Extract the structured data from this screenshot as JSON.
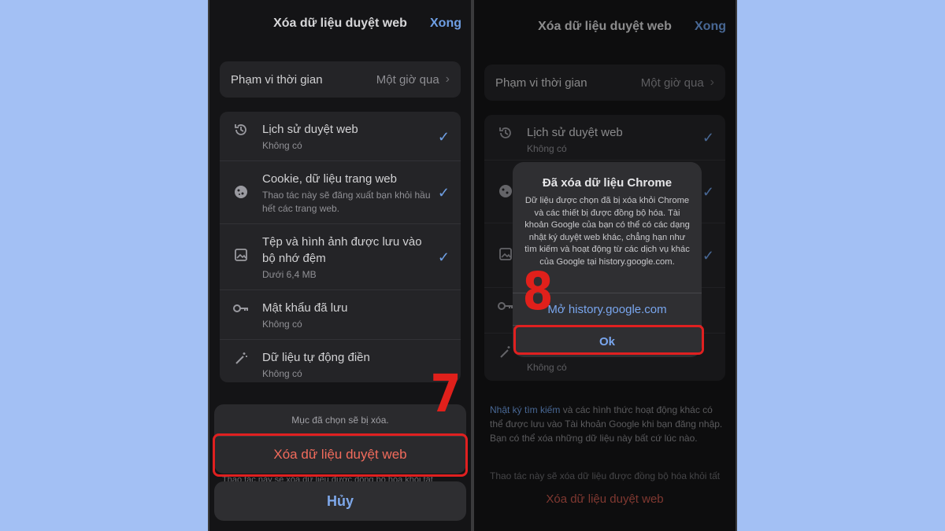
{
  "left": {
    "header": {
      "title": "Xóa dữ liệu duyệt web",
      "done": "Xong"
    },
    "range": {
      "label": "Phạm vi thời gian",
      "value": "Một giờ qua"
    },
    "items": [
      {
        "icon": "history-icon",
        "title": "Lịch sử duyệt web",
        "subtitle": "Không có",
        "checked": true
      },
      {
        "icon": "cookie-icon",
        "title": "Cookie, dữ liệu trang web",
        "subtitle": "Thao tác này sẽ đăng xuất bạn khỏi hầu hết các trang web.",
        "checked": true
      },
      {
        "icon": "image-icon",
        "title": "Tệp và hình ảnh được lưu vào bộ nhớ đệm",
        "subtitle": "Dưới 6,4 MB",
        "checked": true
      },
      {
        "icon": "key-icon",
        "title": "Mật khẩu đã lưu",
        "subtitle": "Không có",
        "checked": false
      },
      {
        "icon": "magic-wand-icon",
        "title": "Dữ liệu tự động điền",
        "subtitle": "Không có",
        "checked": false
      }
    ],
    "sheet": {
      "message": "Mục đã chọn sẽ bị xóa.",
      "action": "Xóa dữ liệu duyệt web",
      "below": "Thao tác này sẽ xóa dữ liệu được đồng bộ hóa khỏi tất",
      "cancel": "Hủy"
    },
    "step": "7"
  },
  "right": {
    "header": {
      "title": "Xóa dữ liệu duyệt web",
      "done": "Xong"
    },
    "range": {
      "label": "Phạm vi thời gian",
      "value": "Một giờ qua"
    },
    "items": [
      {
        "icon": "history-icon",
        "title": "Lịch sử duyệt web",
        "subtitle": "Không có",
        "checked": true
      },
      {
        "icon": "cookie-icon",
        "title": "",
        "subtitle": "",
        "checked": true
      },
      {
        "icon": "image-icon",
        "title": "",
        "subtitle": "",
        "checked": true
      },
      {
        "icon": "key-icon",
        "title": "",
        "subtitle": "",
        "checked": false
      },
      {
        "icon": "magic-wand-icon",
        "title": "",
        "subtitle": "Không có",
        "checked": false
      }
    ],
    "info": {
      "link": "Nhật ký tìm kiếm",
      "text": " và các hình thức hoạt động khác có thể được lưu vào Tài khoản Google khi bạn đăng nhập. Bạn có thể xóa những dữ liệu này bất cứ lúc nào."
    },
    "info2": "Thao tác này sẽ xóa dữ liệu được đồng bộ hóa khỏi tất",
    "action": "Xóa dữ liệu duyệt web",
    "alert": {
      "title": "Đã xóa dữ liệu Chrome",
      "body": "Dữ liệu được chọn đã bị xóa khỏi Chrome và các thiết bị được đồng bộ hóa. Tài khoản Google của bạn có thể có các dạng nhật ký duyệt web khác, chẳng hạn như tìm kiếm và hoạt động từ các dịch vụ khác của Google tại history.google.com.",
      "open_button": "Mở history.google.com",
      "ok_button": "Ok"
    },
    "step": "8"
  },
  "colors": {
    "accent": "#6f9fe4",
    "danger": "#f26b5c",
    "highlight": "#e02020",
    "background": "#a3c0f4"
  }
}
